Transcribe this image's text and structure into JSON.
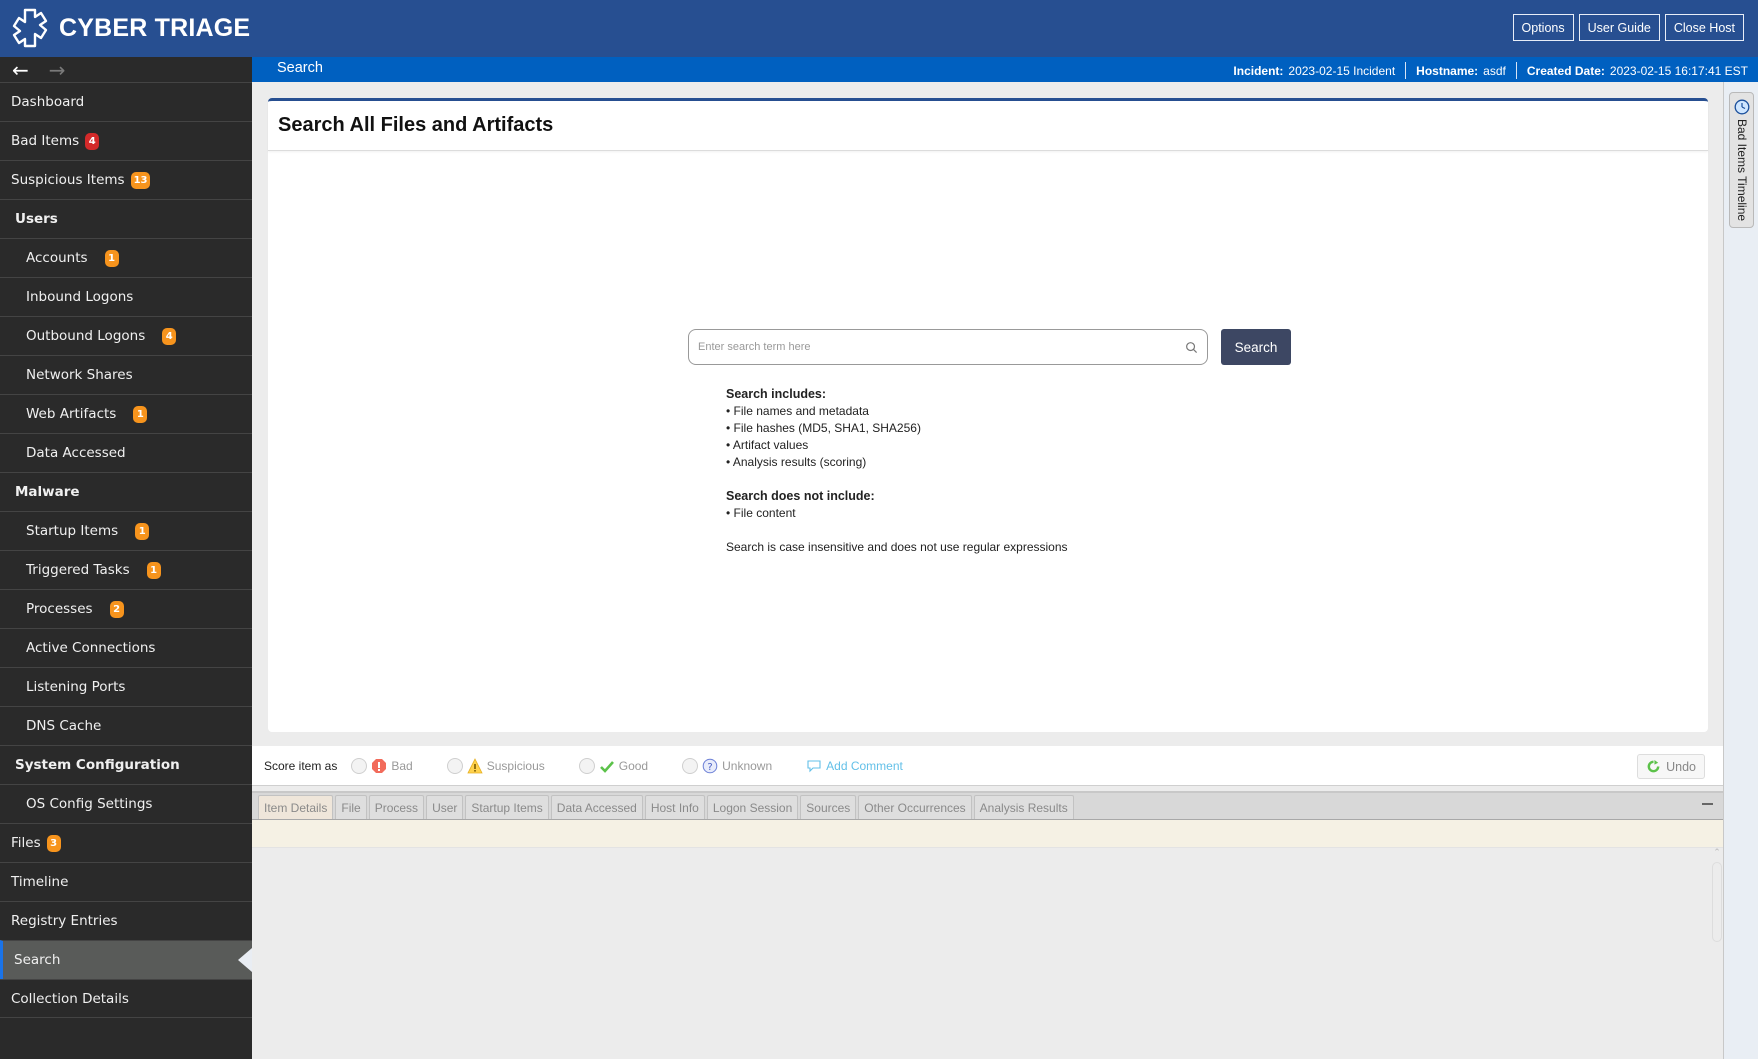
{
  "app": {
    "title": "CYBER TRIAGE",
    "top_buttons": [
      "Options",
      "User Guide",
      "Close Host"
    ]
  },
  "subbar": {
    "page_title": "Search",
    "incident_label": "Incident:",
    "incident_value": "2023-02-15 Incident",
    "hostname_label": "Hostname:",
    "hostname_value": "asdf",
    "created_label": "Created Date:",
    "created_value": "2023-02-15 16:17:41 EST"
  },
  "sidebar": {
    "items": [
      {
        "label": "Dashboard",
        "type": "top"
      },
      {
        "label": "Bad Items",
        "type": "top",
        "badge": "4",
        "badge_color": "red"
      },
      {
        "label": "Suspicious Items",
        "type": "top",
        "badge": "13",
        "badge_color": "orange"
      },
      {
        "label": "Users",
        "type": "header"
      },
      {
        "label": "Accounts",
        "type": "sub",
        "badge": "1",
        "badge_color": "orange"
      },
      {
        "label": "Inbound Logons",
        "type": "sub"
      },
      {
        "label": "Outbound Logons",
        "type": "sub",
        "badge": "4",
        "badge_color": "orange"
      },
      {
        "label": "Network Shares",
        "type": "sub"
      },
      {
        "label": "Web Artifacts",
        "type": "sub",
        "badge": "1",
        "badge_color": "orange"
      },
      {
        "label": "Data Accessed",
        "type": "sub"
      },
      {
        "label": "Malware",
        "type": "header"
      },
      {
        "label": "Startup Items",
        "type": "sub",
        "badge": "1",
        "badge_color": "orange"
      },
      {
        "label": "Triggered Tasks",
        "type": "sub",
        "badge": "1",
        "badge_color": "orange"
      },
      {
        "label": "Processes",
        "type": "sub",
        "badge": "2",
        "badge_color": "orange"
      },
      {
        "label": "Active Connections",
        "type": "sub"
      },
      {
        "label": "Listening Ports",
        "type": "sub"
      },
      {
        "label": "DNS Cache",
        "type": "sub"
      },
      {
        "label": "System Configuration",
        "type": "header"
      },
      {
        "label": "OS Config Settings",
        "type": "sub"
      },
      {
        "label": "Files",
        "type": "top",
        "badge": "3",
        "badge_color": "orange"
      },
      {
        "label": "Timeline",
        "type": "top"
      },
      {
        "label": "Registry Entries",
        "type": "top"
      },
      {
        "label": "Search",
        "type": "top",
        "active": true
      },
      {
        "label": "Collection Details",
        "type": "top"
      }
    ]
  },
  "main": {
    "card_title": "Search All Files and Artifacts",
    "search_placeholder": "Enter search term here",
    "search_value": "",
    "search_button": "Search",
    "includes_title": "Search includes:",
    "includes": [
      "File names and metadata",
      "File hashes (MD5, SHA1, SHA256)",
      "Artifact values",
      "Analysis results (scoring)"
    ],
    "excludes_title": "Search does not include:",
    "excludes": [
      "File content"
    ],
    "note": "Search is case insensitive and does not use regular expressions"
  },
  "scorebar": {
    "label": "Score item as",
    "options": [
      "Bad",
      "Suspicious",
      "Good",
      "Unknown"
    ],
    "add_comment": "Add Comment",
    "undo": "Undo"
  },
  "tabs": [
    "Item Details",
    "File",
    "Process",
    "User",
    "Startup Items",
    "Data Accessed",
    "Host Info",
    "Logon Session",
    "Sources",
    "Other Occurrences",
    "Analysis Results"
  ],
  "active_tab": "Item Details",
  "right_panel": {
    "timeline_label": "Bad Items Timeline"
  },
  "colors": {
    "header_blue": "#274f91",
    "subbar_blue": "#0060c0",
    "sidebar_bg": "#2a2a2a",
    "active_item": "#595b59",
    "badge_red": "#d42a2a",
    "badge_orange": "#f7941d",
    "search_button": "#3d4763",
    "comment_link": "#63c0e8"
  }
}
